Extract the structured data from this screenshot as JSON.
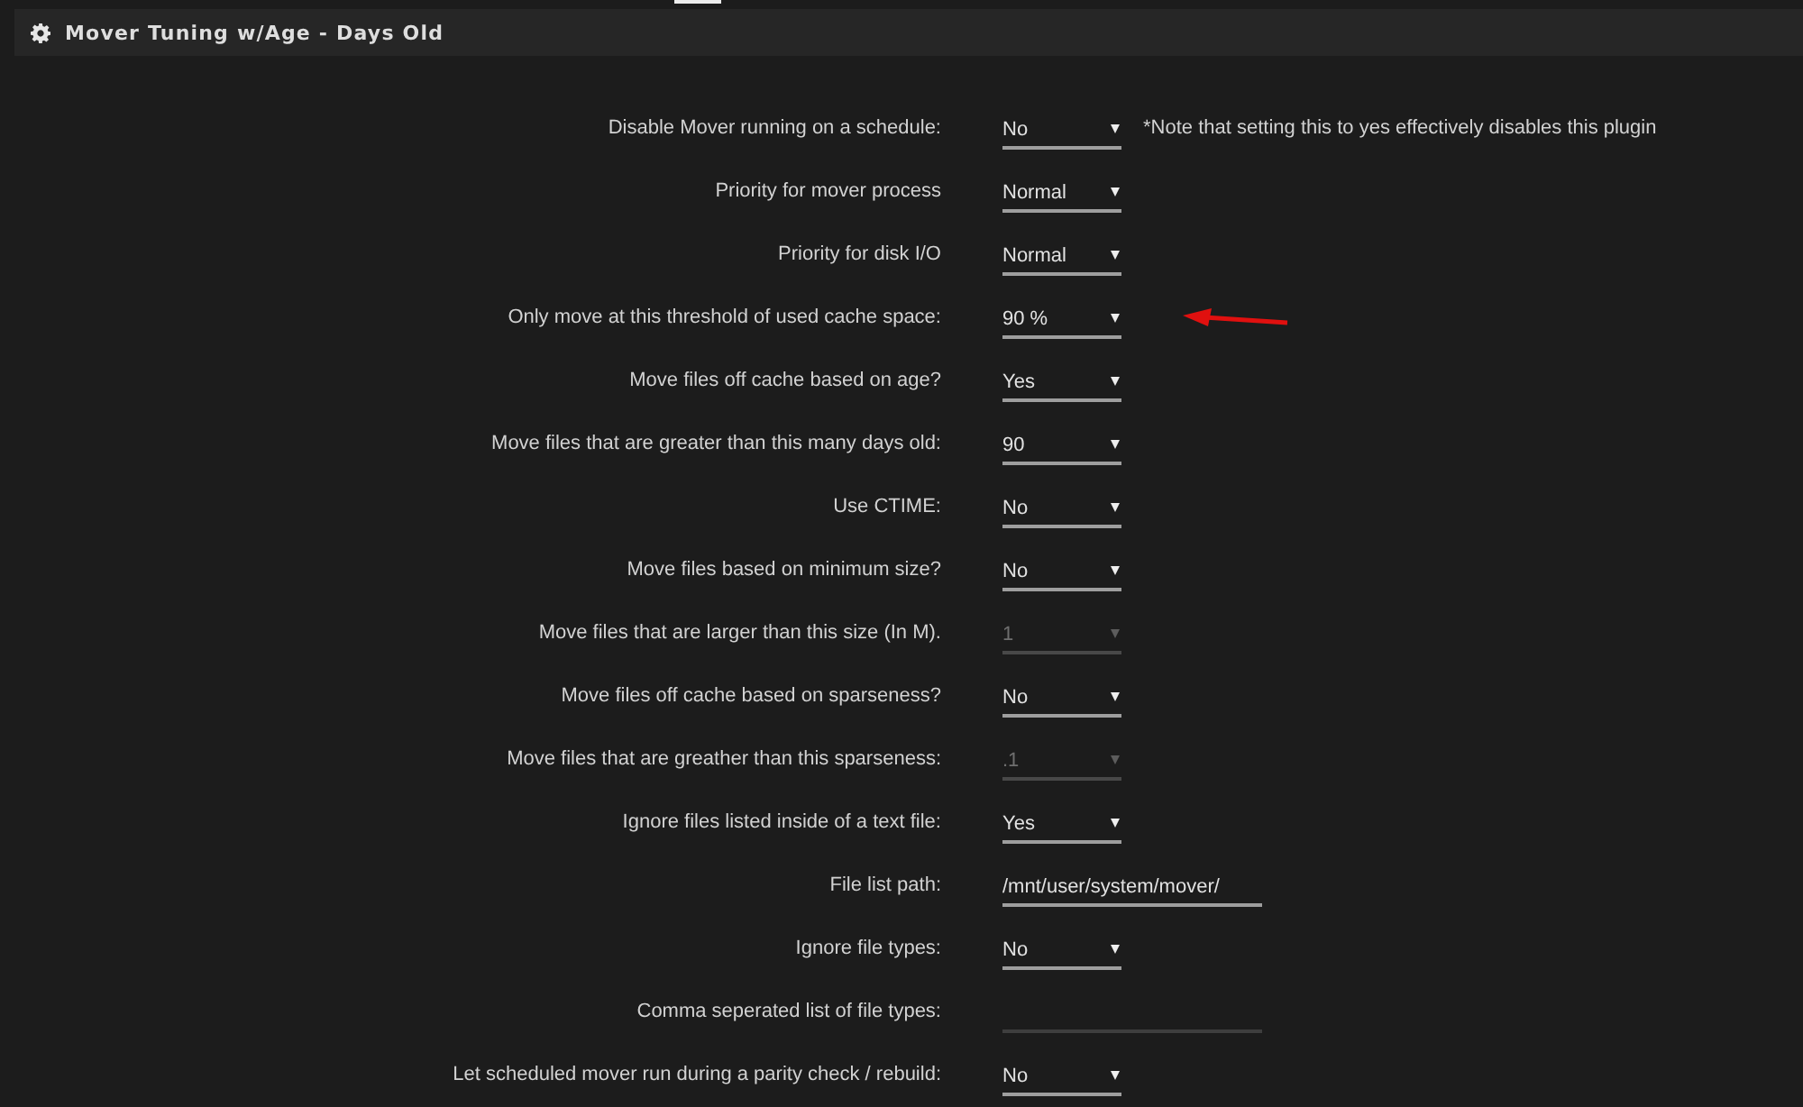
{
  "header": {
    "title": "Mover Tuning w/Age - Days Old"
  },
  "settings": [
    {
      "label": "Disable Mover running on a schedule:",
      "kind": "select",
      "value": "No",
      "disabled": false,
      "note": "*Note that setting this to yes effectively disables this plugin"
    },
    {
      "label": "Priority for mover process",
      "kind": "select",
      "value": "Normal",
      "disabled": false
    },
    {
      "label": "Priority for disk I/O",
      "kind": "select",
      "value": "Normal",
      "disabled": false
    },
    {
      "label": "Only move at this threshold of used cache space:",
      "kind": "select",
      "value": "90 %",
      "disabled": false
    },
    {
      "label": "Move files off cache based on age?",
      "kind": "select",
      "value": "Yes",
      "disabled": false
    },
    {
      "label": "Move files that are greater than this many days old:",
      "kind": "select",
      "value": "90",
      "disabled": false
    },
    {
      "label": "Use CTIME:",
      "kind": "select",
      "value": "No",
      "disabled": false
    },
    {
      "label": "Move files based on minimum size?",
      "kind": "select",
      "value": "No",
      "disabled": false
    },
    {
      "label": "Move files that are larger than this size (In M).",
      "kind": "select",
      "value": "1",
      "disabled": true
    },
    {
      "label": "Move files off cache based on sparseness?",
      "kind": "select",
      "value": "No",
      "disabled": false
    },
    {
      "label": "Move files that are greather than this sparseness:",
      "kind": "select",
      "value": ".1",
      "disabled": true
    },
    {
      "label": "Ignore files listed inside of a text file:",
      "kind": "select",
      "value": "Yes",
      "disabled": false
    },
    {
      "label": "File list path:",
      "kind": "text",
      "value": "/mnt/user/system/mover/",
      "disabled": false
    },
    {
      "label": "Ignore file types:",
      "kind": "select",
      "value": "No",
      "disabled": false
    },
    {
      "label": "Comma seperated list of file types:",
      "kind": "text",
      "disabled": true
    },
    {
      "label": "Let scheduled mover run during a parity check / rebuild:",
      "kind": "select",
      "value": "No",
      "disabled": false
    }
  ]
}
